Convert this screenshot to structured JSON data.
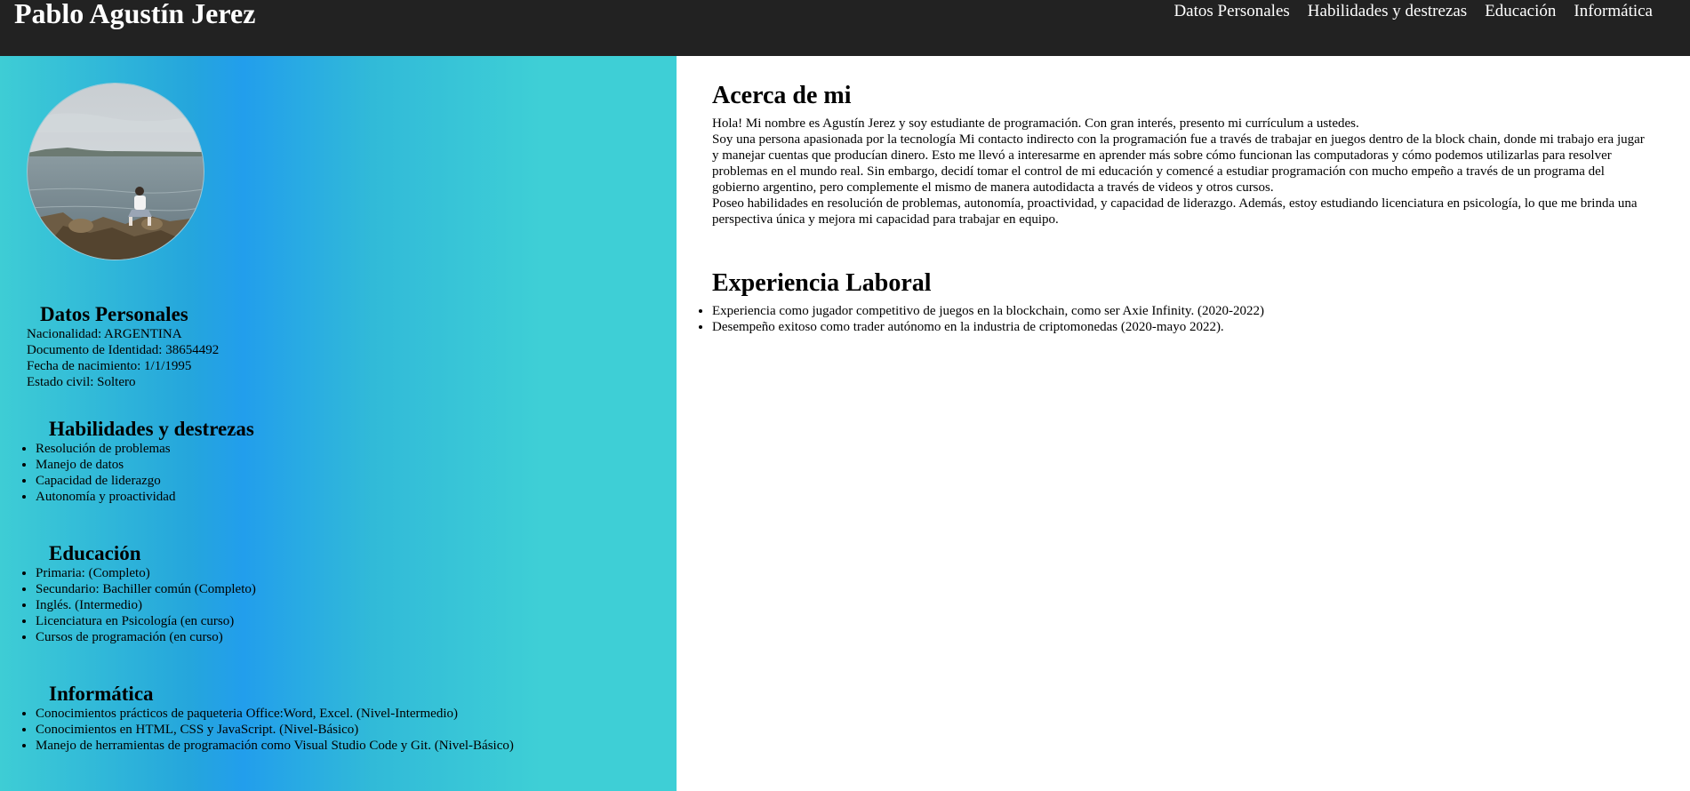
{
  "header": {
    "title": "Pablo Agustín Jerez",
    "nav": [
      "Datos Personales",
      "Habilidades y destrezas",
      "Educación",
      "Informática"
    ]
  },
  "sidebar": {
    "personal": {
      "heading": "Datos Personales",
      "lines": [
        "Nacionalidad: ARGENTINA",
        "Documento de Identidad: 38654492",
        "Fecha de nacimiento: 1/1/1995",
        "Estado civil: Soltero"
      ]
    },
    "skills": {
      "heading": "Habilidades y destrezas",
      "items": [
        "Resolución de problemas",
        "Manejo de datos",
        "Capacidad de liderazgo",
        "Autonomía y proactividad"
      ]
    },
    "education": {
      "heading": "Educación",
      "items": [
        "Primaria: (Completo)",
        "Secundario: Bachiller común (Completo)",
        "Inglés. (Intermedio)",
        "Licenciatura en Psicología (en curso)",
        "Cursos de programación (en curso)"
      ]
    },
    "it": {
      "heading": "Informática",
      "items": [
        "Conocimientos prácticos de paqueteria Office:Word, Excel. (Nivel-Intermedio)",
        "Conocimientos en HTML, CSS y JavaScript. (Nivel-Básico)",
        "Manejo de herramientas de programación como Visual Studio Code y Git. (Nivel-Básico)"
      ]
    }
  },
  "main": {
    "about": {
      "heading": "Acerca de mi",
      "paragraphs": [
        "Hola! Mi nombre es Agustín Jerez y soy estudiante de programación. Con gran interés, presento mi currículum a ustedes.",
        "Soy una persona apasionada por la tecnología Mi contacto indirecto con la programación fue a través de trabajar en juegos dentro de la block chain, donde mi trabajo era jugar y manejar cuentas que producían dinero. Esto me llevó a interesarme en aprender más sobre cómo funcionan las computadoras y cómo podemos utilizarlas para resolver problemas en el mundo real. Sin embargo, decidí tomar el control de mi educación y comencé a estudiar programación con mucho empeño a través de un programa del gobierno argentino, pero complemente el mismo de manera autodidacta a través de videos y otros cursos.",
        "Poseo habilidades en resolución de problemas, autonomía, proactividad, y capacidad de liderazgo. Además, estoy estudiando licenciatura en psicología, lo que me brinda una perspectiva única y mejora mi capacidad para trabajar en equipo."
      ]
    },
    "experience": {
      "heading": "Experiencia Laboral",
      "items": [
        "Experiencia como jugador competitivo de juegos en la blockchain, como ser Axie Infinity. (2020-2022)",
        "Desempeño exitoso como trader autónomo en la industria de criptomonedas (2020-mayo 2022)."
      ]
    }
  }
}
